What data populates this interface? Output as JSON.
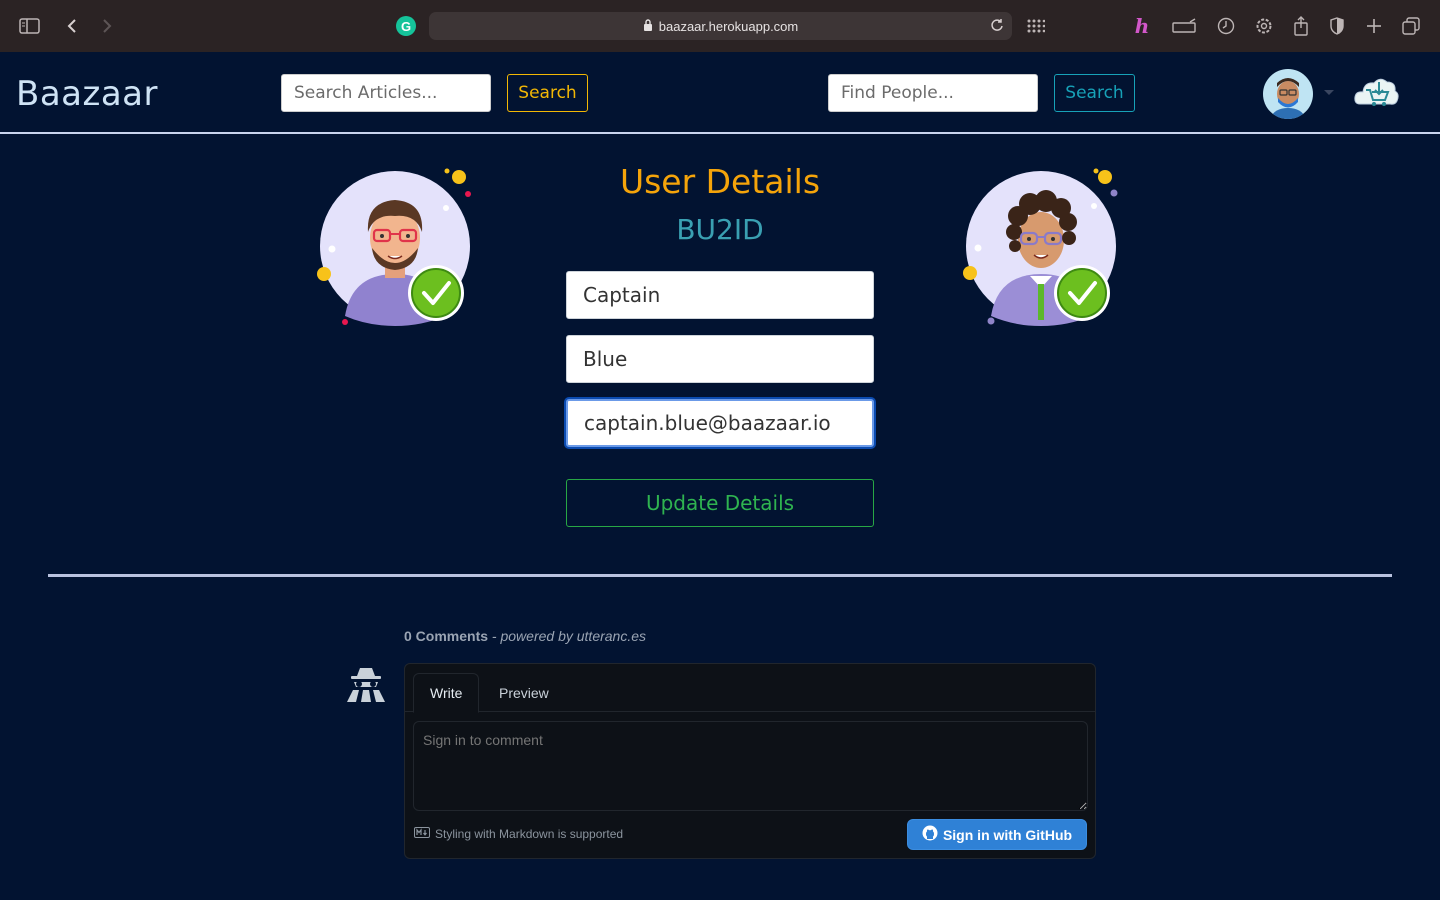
{
  "browser": {
    "url": "baazaar.herokuapp.com"
  },
  "navbar": {
    "brand": "Baazaar",
    "article_search_placeholder": "Search Articles...",
    "article_search_button": "Search",
    "people_search_placeholder": "Find People...",
    "people_search_button": "Search"
  },
  "user_details": {
    "title": "User Details",
    "user_id": "BU2ID",
    "first_name": "Captain",
    "last_name": "Blue",
    "email": "captain.blue@baazaar.io",
    "update_button": "Update Details"
  },
  "comments": {
    "count_label": "0 Comments",
    "separator": " - ",
    "powered_by": "powered by utteranc.es",
    "tab_write": "Write",
    "tab_preview": "Preview",
    "textarea_placeholder": "Sign in to comment",
    "markdown_note": "Styling with Markdown is supported",
    "signin_button": "Sign in with GitHub"
  },
  "colors": {
    "background": "#021331",
    "accent_yellow": "#f5a40a",
    "accent_cyan": "#17a2b8",
    "success_green": "#28a745",
    "github_blue": "#2f81d6"
  }
}
